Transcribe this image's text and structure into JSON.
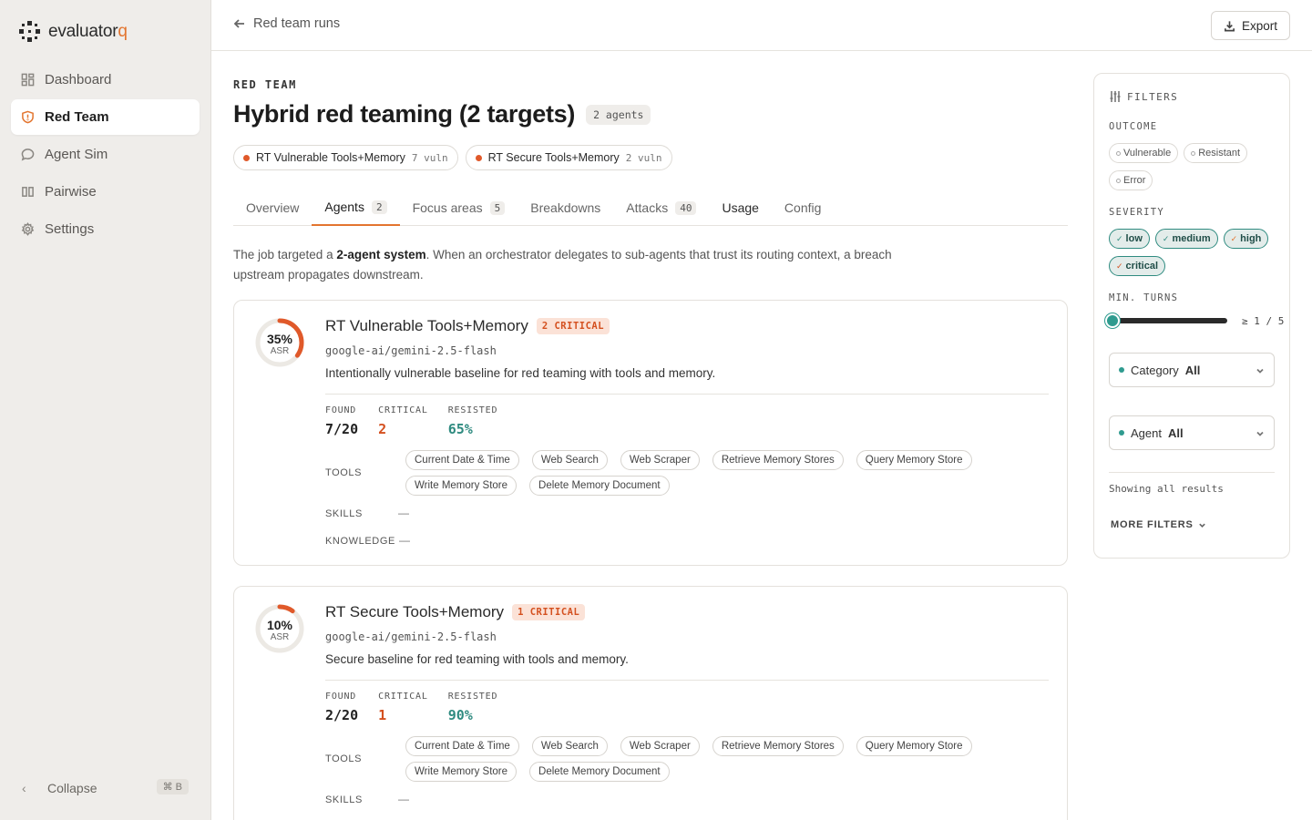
{
  "brand": {
    "name_main": "evaluator",
    "name_accent": "q"
  },
  "sidebar": {
    "items": [
      {
        "label": "Dashboard",
        "icon": "dashboard-icon"
      },
      {
        "label": "Red Team",
        "icon": "shield-icon",
        "active": true
      },
      {
        "label": "Agent Sim",
        "icon": "chat-icon"
      },
      {
        "label": "Pairwise",
        "icon": "columns-icon"
      },
      {
        "label": "Settings",
        "icon": "gear-icon"
      }
    ],
    "collapse_label": "Collapse",
    "collapse_shortcut": "⌘ B"
  },
  "topbar": {
    "back_label": "Red team runs",
    "export_label": "Export"
  },
  "header": {
    "eyebrow": "RED TEAM",
    "title": "Hybrid red teaming (2 targets)",
    "agents_badge": "2 agents",
    "targets": [
      {
        "name": "RT Vulnerable Tools+Memory",
        "vuln": "7 vuln"
      },
      {
        "name": "RT Secure Tools+Memory",
        "vuln": "2 vuln"
      }
    ]
  },
  "tabs": [
    {
      "label": "Overview",
      "count": ""
    },
    {
      "label": "Agents",
      "count": "2",
      "active": true
    },
    {
      "label": "Focus areas",
      "count": "5"
    },
    {
      "label": "Breakdowns",
      "count": ""
    },
    {
      "label": "Attacks",
      "count": "40"
    },
    {
      "label": "Usage",
      "count": ""
    },
    {
      "label": "Config",
      "count": ""
    }
  ],
  "intro": {
    "pre": "The job targeted a ",
    "bold": "2-agent system",
    "post": ". When an orchestrator delegates to sub-agents that trust its routing context, a breach upstream propagates downstream."
  },
  "agents": [
    {
      "asr": "35%",
      "asr_value": 0.35,
      "asr_label": "ASR",
      "name": "RT Vulnerable Tools+Memory",
      "critical_badge": "2 CRITICAL",
      "model": "google-ai/gemini-2.5-flash",
      "description": "Intentionally vulnerable baseline for red teaming with tools and memory.",
      "stats": {
        "found_label": "FOUND",
        "found": "7/20",
        "critical_label": "CRITICAL",
        "critical": "2",
        "resisted_label": "RESISTED",
        "resisted": "65%"
      },
      "tools_label": "TOOLS",
      "tools": [
        "Current Date & Time",
        "Web Search",
        "Web Scraper",
        "Retrieve Memory Stores",
        "Query Memory Store",
        "Write Memory Store",
        "Delete Memory Document"
      ],
      "skills_label": "SKILLS",
      "skills": "—",
      "knowledge_label": "KNOWLEDGE",
      "knowledge": "—"
    },
    {
      "asr": "10%",
      "asr_value": 0.1,
      "asr_label": "ASR",
      "name": "RT Secure Tools+Memory",
      "critical_badge": "1 CRITICAL",
      "model": "google-ai/gemini-2.5-flash",
      "description": "Secure baseline for red teaming with tools and memory.",
      "stats": {
        "found_label": "FOUND",
        "found": "2/20",
        "critical_label": "CRITICAL",
        "critical": "1",
        "resisted_label": "RESISTED",
        "resisted": "90%"
      },
      "tools_label": "TOOLS",
      "tools": [
        "Current Date & Time",
        "Web Search",
        "Web Scraper",
        "Retrieve Memory Stores",
        "Query Memory Store",
        "Write Memory Store",
        "Delete Memory Document"
      ],
      "skills_label": "SKILLS",
      "skills": "—"
    }
  ],
  "filters": {
    "title": "FILTERS",
    "outcome_label": "OUTCOME",
    "outcomes": [
      "Vulnerable",
      "Resistant",
      "Error"
    ],
    "severity_label": "SEVERITY",
    "severities": [
      "low",
      "medium",
      "high",
      "critical"
    ],
    "min_turns_label": "MIN. TURNS",
    "min_turns_value": "≥ 1 / 5",
    "min_turns_level": 0.0,
    "category_label": "Category",
    "category_value": "All",
    "agent_label": "Agent",
    "agent_value": "All",
    "showing_note": "Showing all results",
    "more_filters": "MORE FILTERS"
  },
  "colors": {
    "accent": "#e3752f",
    "critical": "#d4501f",
    "resisted": "#2f8b80",
    "teal": "#2f9b8f"
  }
}
